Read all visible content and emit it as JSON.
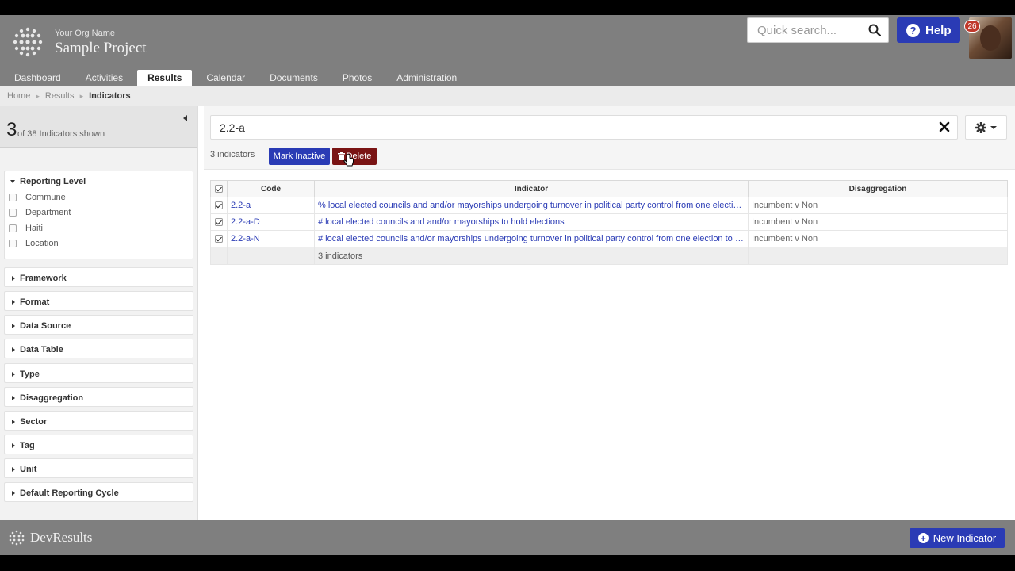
{
  "header": {
    "org_name": "Your Org Name",
    "project_name": "Sample Project",
    "search_placeholder": "Quick search...",
    "help_label": "Help",
    "notification_count": "26"
  },
  "nav": {
    "items": [
      "Dashboard",
      "Activities",
      "Results",
      "Calendar",
      "Documents",
      "Photos",
      "Administration"
    ],
    "active": "Results"
  },
  "breadcrumb": [
    "Home",
    "Results",
    "Indicators"
  ],
  "sidebar": {
    "count": "3",
    "count_text": "of 38 Indicators shown",
    "facets": [
      {
        "title": "Reporting Level",
        "expanded": true,
        "options": [
          "Commune",
          "Department",
          "Haiti",
          "Location"
        ]
      },
      {
        "title": "Framework"
      },
      {
        "title": "Format"
      },
      {
        "title": "Data Source"
      },
      {
        "title": "Data Table"
      },
      {
        "title": "Type"
      },
      {
        "title": "Disaggregation"
      },
      {
        "title": "Sector"
      },
      {
        "title": "Tag"
      },
      {
        "title": "Unit"
      },
      {
        "title": "Default Reporting Cycle"
      }
    ]
  },
  "main": {
    "filter_value": "2.2-a",
    "result_count": "3 indicators",
    "mark_inactive_label": "Mark Inactive",
    "delete_label": "Delete",
    "table": {
      "columns": [
        "Code",
        "Indicator",
        "Disaggregation"
      ],
      "rows": [
        {
          "code": "2.2-a",
          "indicator": "% local elected councils and and/or mayorships undergoing turnover in political party control from one election to t...",
          "disaggregation": "Incumbent v Non"
        },
        {
          "code": "2.2-a-D",
          "indicator": "# local elected councils and and/or mayorships to hold elections",
          "disaggregation": "Incumbent v Non"
        },
        {
          "code": "2.2-a-N",
          "indicator": "# local elected councils and/or mayorships undergoing turnover in political party control from one election to the next",
          "disaggregation": "Incumbent v Non"
        }
      ],
      "footer": "3 indicators"
    }
  },
  "bottombar": {
    "brand": "DevResults",
    "new_indicator_label": "New Indicator"
  },
  "colors": {
    "primary_blue": "#2a3bb5",
    "delete_red": "#7a1414",
    "header_gray": "#7f7f7f"
  }
}
